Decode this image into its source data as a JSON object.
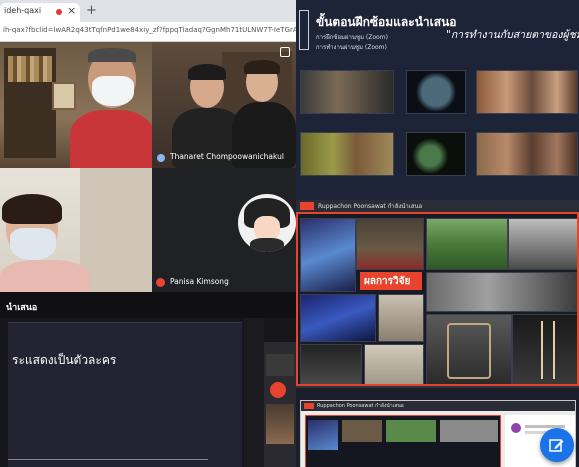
{
  "browser": {
    "tab_title": "ideh-qaxi",
    "close_glyph": "×",
    "new_tab_glyph": "+",
    "url": "ih-qax?fbclid=IwAR2q43tTqfnPd1we84xiy_zf?fppqTiadaq?GgnMh71tULNW7T-IeTGrAc"
  },
  "meet": {
    "participants": [
      {
        "name": "Thanaret Chompoowanichakul"
      },
      {
        "name": "Panisa Kimsong"
      }
    ]
  },
  "slide1": {
    "title": "ขั้นตอนฝึกซ้อมและนำเสนอ",
    "line1": "การฝึกซ้อมผ่านซูม (Zoom)",
    "line2": "การทำงานผ่านซูม (Zoom)",
    "quote": "\"การทำงานกับสายตาของผู้ชม\""
  },
  "slide2": {
    "presenter": "Ruppachon Poonsawat กำลังนำเสนอ",
    "banner": "ผลการวิจัย"
  },
  "slide3": {
    "header": "นำเสนอ",
    "body": "ระแสดงเป็นตัวละคร"
  },
  "slide4": {
    "presenter": "Ruppachon Poonsawat กำลังนำเสนอ"
  },
  "colors": {
    "meet_dark": "#202124",
    "slide_navy": "#1f2638",
    "accent_red": "#e8432c",
    "fab_blue": "#1a73e8"
  },
  "icons": [
    "close-icon",
    "add-tab-icon",
    "pin-icon",
    "mic-off-icon",
    "audio-level-icon",
    "edit-icon"
  ]
}
